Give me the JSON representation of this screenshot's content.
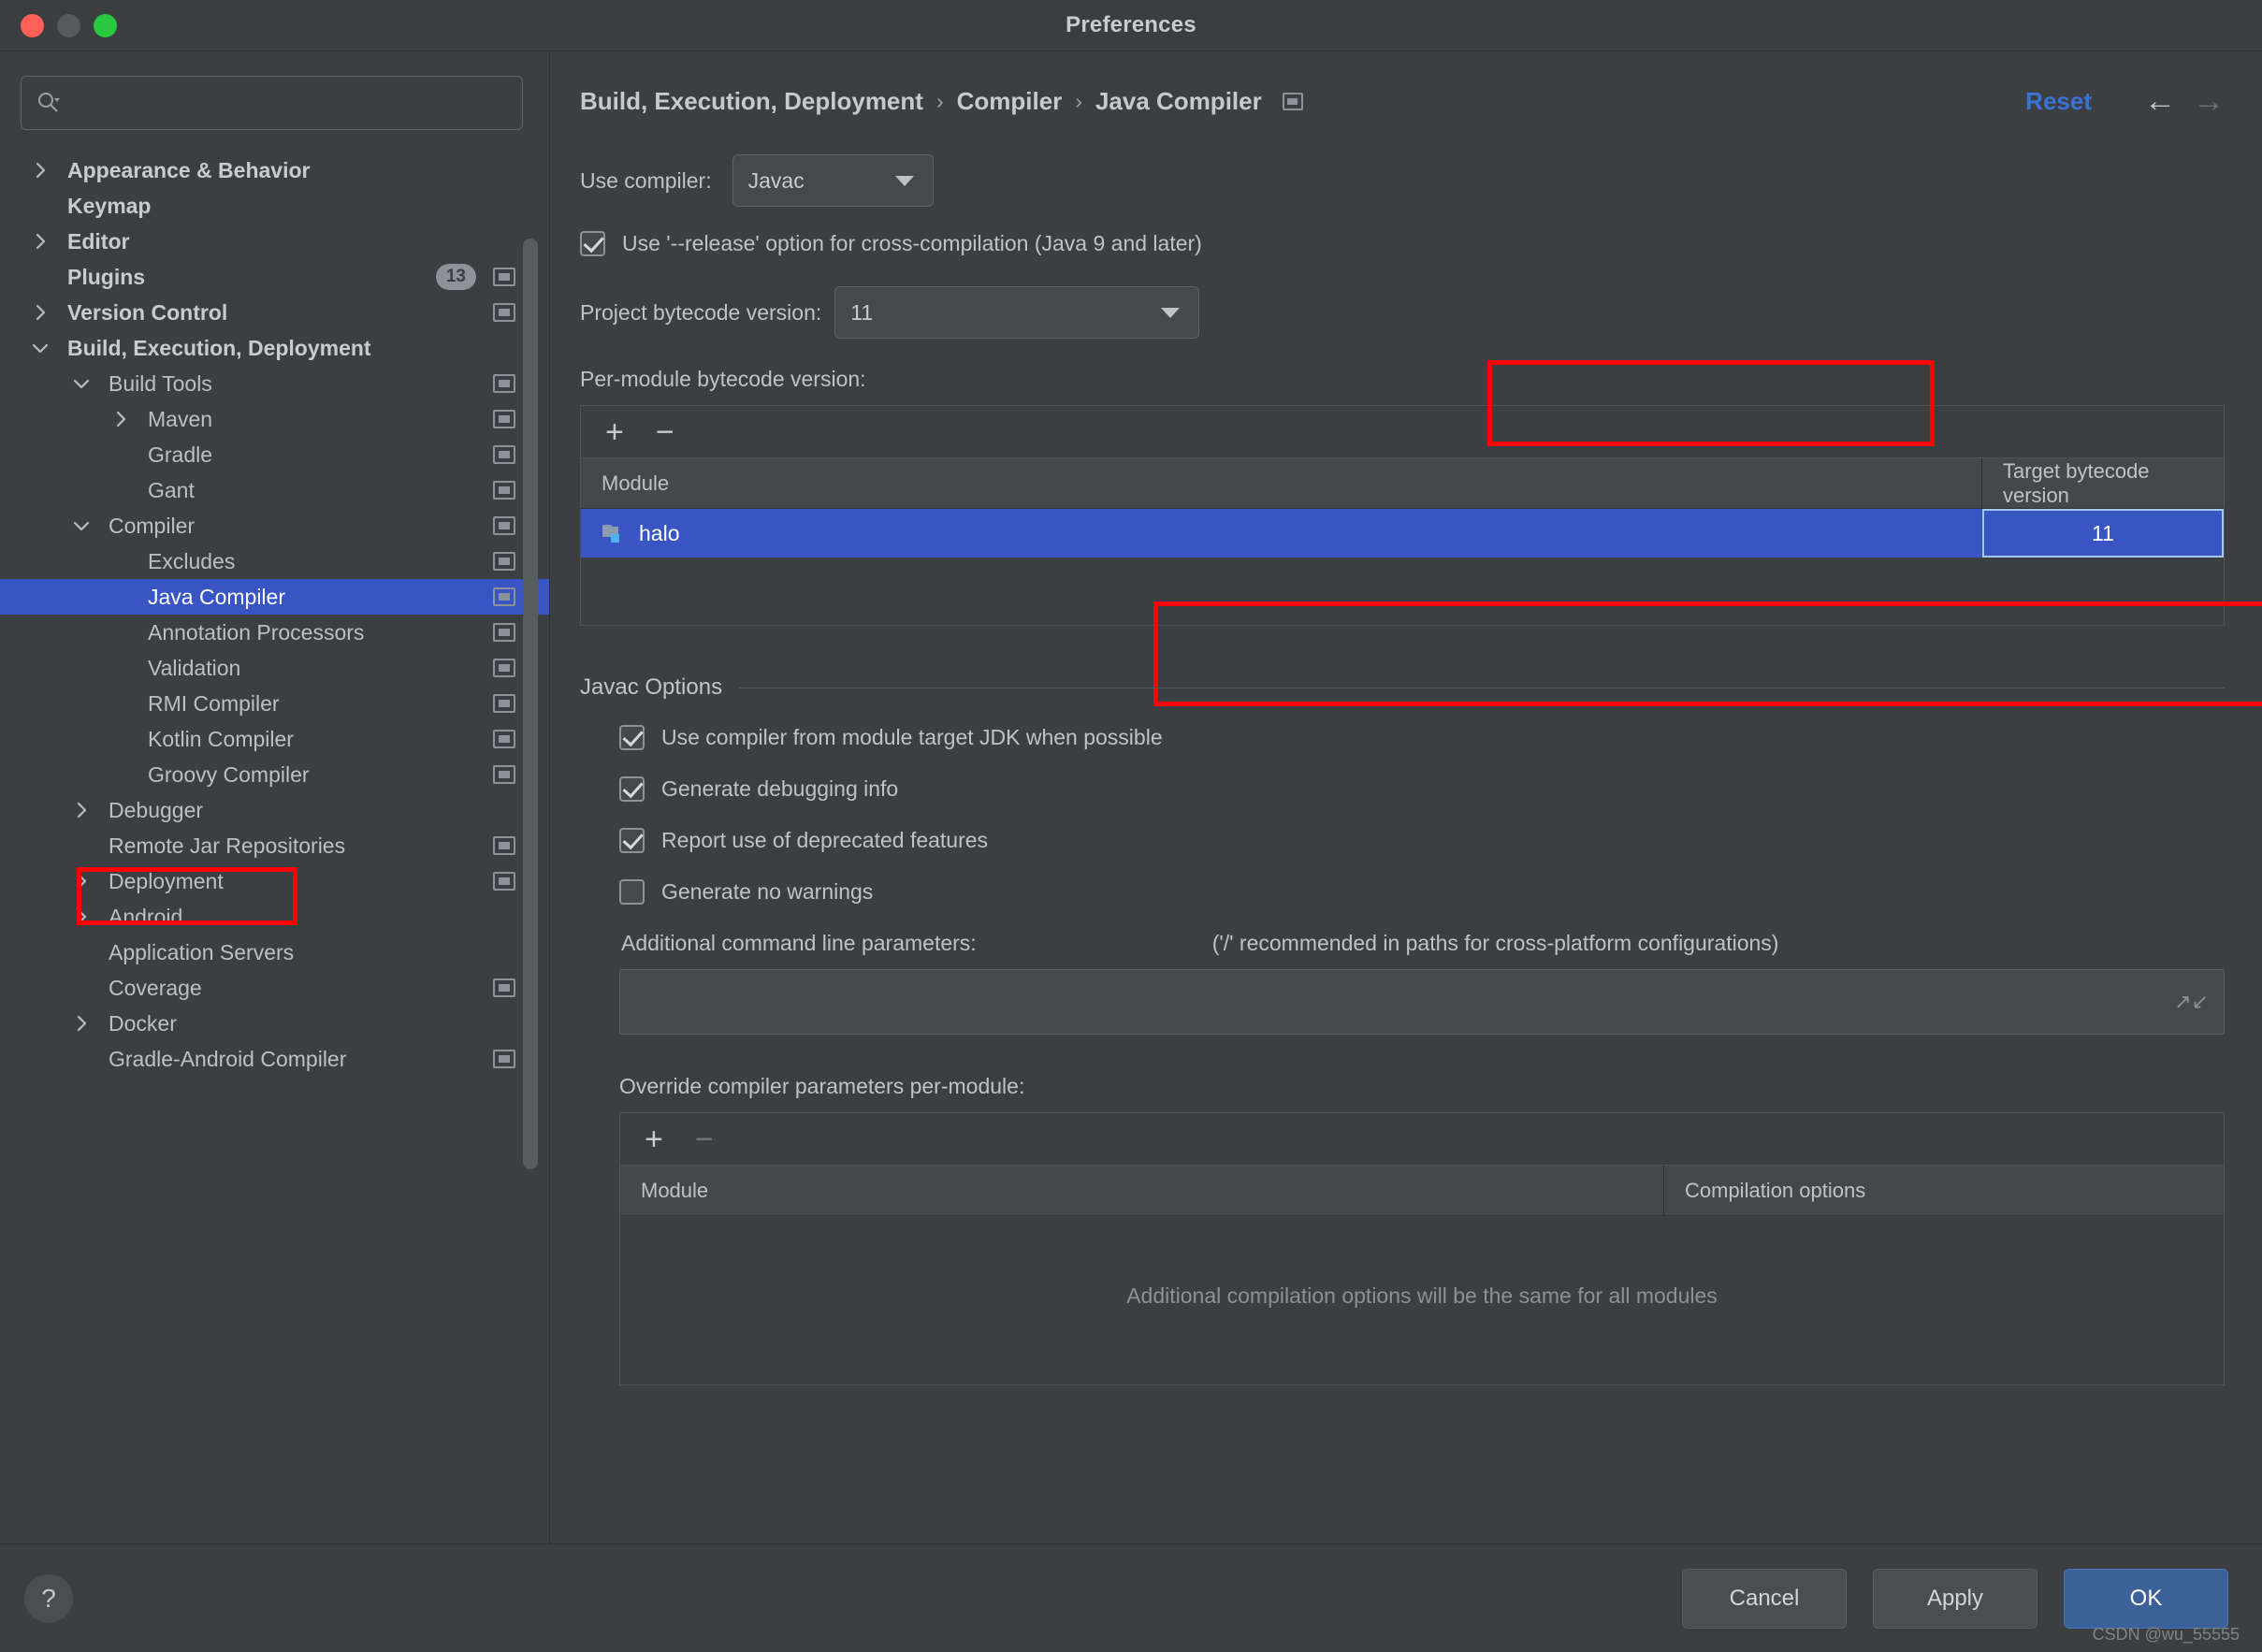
{
  "window": {
    "title": "Preferences",
    "traffic_lights": [
      "close",
      "minimize",
      "zoom"
    ]
  },
  "search": {
    "value": "",
    "placeholder": ""
  },
  "sidebar": {
    "items": [
      {
        "label": "Appearance & Behavior",
        "level": 0,
        "arrow": "right",
        "bold": true,
        "mod_icon": false,
        "badge": null,
        "selected": false
      },
      {
        "label": "Keymap",
        "level": 0,
        "arrow": "none",
        "bold": true,
        "mod_icon": false,
        "badge": null,
        "selected": false
      },
      {
        "label": "Editor",
        "level": 0,
        "arrow": "right",
        "bold": true,
        "mod_icon": false,
        "badge": null,
        "selected": false
      },
      {
        "label": "Plugins",
        "level": 0,
        "arrow": "none",
        "bold": true,
        "mod_icon": true,
        "badge": "13",
        "selected": false
      },
      {
        "label": "Version Control",
        "level": 0,
        "arrow": "right",
        "bold": true,
        "mod_icon": true,
        "badge": null,
        "selected": false
      },
      {
        "label": "Build, Execution, Deployment",
        "level": 0,
        "arrow": "down",
        "bold": true,
        "mod_icon": false,
        "badge": null,
        "selected": false
      },
      {
        "label": "Build Tools",
        "level": 1,
        "arrow": "down",
        "bold": false,
        "mod_icon": true,
        "badge": null,
        "selected": false
      },
      {
        "label": "Maven",
        "level": 2,
        "arrow": "right",
        "bold": false,
        "mod_icon": true,
        "badge": null,
        "selected": false
      },
      {
        "label": "Gradle",
        "level": 2,
        "arrow": "none",
        "bold": false,
        "mod_icon": true,
        "badge": null,
        "selected": false
      },
      {
        "label": "Gant",
        "level": 2,
        "arrow": "none",
        "bold": false,
        "mod_icon": true,
        "badge": null,
        "selected": false
      },
      {
        "label": "Compiler",
        "level": 1,
        "arrow": "down",
        "bold": false,
        "mod_icon": true,
        "badge": null,
        "selected": false
      },
      {
        "label": "Excludes",
        "level": 2,
        "arrow": "none",
        "bold": false,
        "mod_icon": true,
        "badge": null,
        "selected": false
      },
      {
        "label": "Java Compiler",
        "level": 2,
        "arrow": "none",
        "bold": false,
        "mod_icon": true,
        "badge": null,
        "selected": true
      },
      {
        "label": "Annotation Processors",
        "level": 2,
        "arrow": "none",
        "bold": false,
        "mod_icon": true,
        "badge": null,
        "selected": false
      },
      {
        "label": "Validation",
        "level": 2,
        "arrow": "none",
        "bold": false,
        "mod_icon": true,
        "badge": null,
        "selected": false
      },
      {
        "label": "RMI Compiler",
        "level": 2,
        "arrow": "none",
        "bold": false,
        "mod_icon": true,
        "badge": null,
        "selected": false
      },
      {
        "label": "Kotlin Compiler",
        "level": 2,
        "arrow": "none",
        "bold": false,
        "mod_icon": true,
        "badge": null,
        "selected": false
      },
      {
        "label": "Groovy Compiler",
        "level": 2,
        "arrow": "none",
        "bold": false,
        "mod_icon": true,
        "badge": null,
        "selected": false
      },
      {
        "label": "Debugger",
        "level": 1,
        "arrow": "right",
        "bold": false,
        "mod_icon": false,
        "badge": null,
        "selected": false
      },
      {
        "label": "Remote Jar Repositories",
        "level": 1,
        "arrow": "none",
        "bold": false,
        "mod_icon": true,
        "badge": null,
        "selected": false
      },
      {
        "label": "Deployment",
        "level": 1,
        "arrow": "right",
        "bold": false,
        "mod_icon": true,
        "badge": null,
        "selected": false
      },
      {
        "label": "Android",
        "level": 1,
        "arrow": "right",
        "bold": false,
        "mod_icon": false,
        "badge": null,
        "selected": false
      },
      {
        "label": "Application Servers",
        "level": 1,
        "arrow": "none",
        "bold": false,
        "mod_icon": false,
        "badge": null,
        "selected": false
      },
      {
        "label": "Coverage",
        "level": 1,
        "arrow": "none",
        "bold": false,
        "mod_icon": true,
        "badge": null,
        "selected": false
      },
      {
        "label": "Docker",
        "level": 1,
        "arrow": "right",
        "bold": false,
        "mod_icon": false,
        "badge": null,
        "selected": false
      },
      {
        "label": "Gradle-Android Compiler",
        "level": 1,
        "arrow": "none",
        "bold": false,
        "mod_icon": true,
        "badge": null,
        "selected": false
      }
    ]
  },
  "header": {
    "breadcrumb": [
      "Build, Execution, Deployment",
      "Compiler",
      "Java Compiler"
    ],
    "separator": "›",
    "reset_label": "Reset",
    "back_arrow": "←",
    "forward_arrow": "→"
  },
  "main": {
    "use_compiler_label": "Use compiler:",
    "use_compiler_value": "Javac",
    "release_option_label": "Use '--release' option for cross-compilation (Java 9 and later)",
    "release_option_checked": true,
    "project_bytecode_label": "Project bytecode version:",
    "project_bytecode_value": "11",
    "per_module_label": "Per-module bytecode version:",
    "per_module_table": {
      "add_label": "+",
      "remove_label": "−",
      "columns": [
        "Module",
        "Target bytecode version"
      ],
      "rows": [
        {
          "module": "halo",
          "target": "11",
          "selected": true
        }
      ]
    },
    "javac_options": {
      "title": "Javac Options",
      "checkboxes": [
        {
          "label": "Use compiler from module target JDK when possible",
          "checked": true
        },
        {
          "label": "Generate debugging info",
          "checked": true
        },
        {
          "label": "Report use of deprecated features",
          "checked": true
        },
        {
          "label": "Generate no warnings",
          "checked": false
        }
      ],
      "params_label": "Additional command line parameters:",
      "params_hint": "('/' recommended in paths for cross-platform configurations)",
      "params_value": "",
      "override_label": "Override compiler parameters per-module:",
      "override_table": {
        "add_label": "+",
        "remove_label": "−",
        "columns": [
          "Module",
          "Compilation options"
        ],
        "empty_message": "Additional compilation options will be the same for all modules"
      }
    }
  },
  "footer": {
    "help_label": "?",
    "cancel_label": "Cancel",
    "apply_label": "Apply",
    "ok_label": "OK",
    "watermark": "CSDN @wu_55555"
  },
  "colors": {
    "accent_selection": "#3955c4",
    "highlight_box": "#fe0000",
    "link": "#3b73d5",
    "primary_button": "#3c6199",
    "window_bg": "#3c3f41"
  }
}
